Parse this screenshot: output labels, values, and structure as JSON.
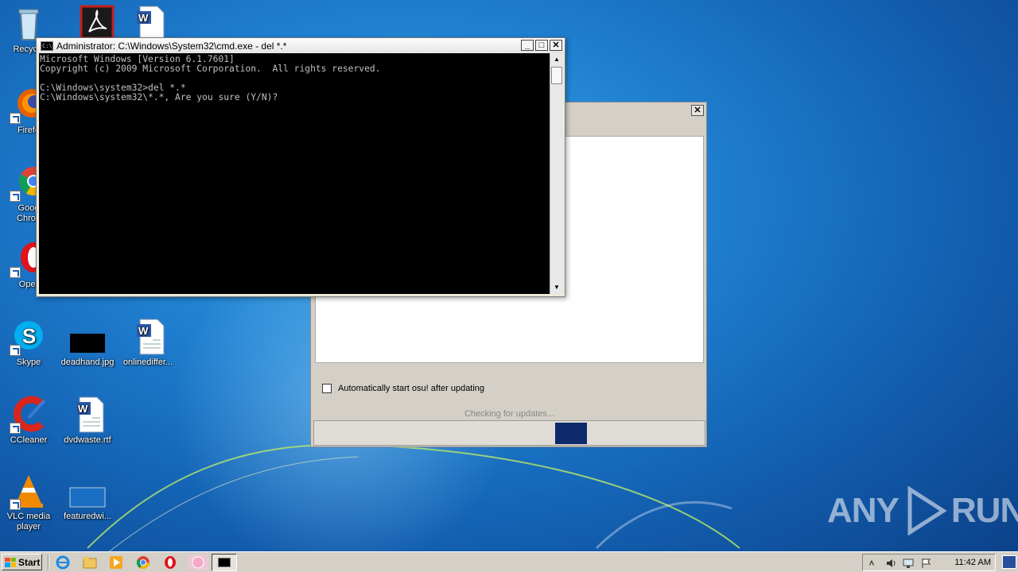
{
  "desktop": {
    "icons": [
      {
        "label": "Recycle",
        "icon": "recycle-bin-icon"
      },
      {
        "label": "Firefox",
        "icon": "firefox-icon"
      },
      {
        "label": "Google Chrome",
        "icon": "chrome-icon"
      },
      {
        "label": "Opera",
        "icon": "opera-icon"
      },
      {
        "label": "Skype",
        "icon": "skype-icon"
      },
      {
        "label": "deadhand.jpg",
        "icon": "image-file-icon"
      },
      {
        "label": "onlinediffer...",
        "icon": "word-doc-icon"
      },
      {
        "label": "CCleaner",
        "icon": "ccleaner-icon"
      },
      {
        "label": "dvdwaste.rtf",
        "icon": "word-doc-icon"
      },
      {
        "label": "VLC media player",
        "icon": "vlc-icon"
      },
      {
        "label": "featuredwi...",
        "icon": "image-file-icon"
      }
    ],
    "partial_labels": {
      "recycle": "Recycle",
      "firefox": "Firefo",
      "chrome_1": "Goog",
      "chrome_2": "Chron",
      "opera": "Oper"
    }
  },
  "cmd": {
    "title": "Administrator: C:\\Windows\\System32\\cmd.exe - del  *.*",
    "icon_text": "C:\\",
    "lines": [
      "Microsoft Windows [Version 6.1.7601]",
      "Copyright (c) 2009 Microsoft Corporation.  All rights reserved.",
      "",
      "C:\\Windows\\system32>del *.*",
      "C:\\Windows\\system32\\*.*, Are you sure (Y/N)?"
    ],
    "min_symbol": "_",
    "max_symbol": "□",
    "close_symbol": "✕"
  },
  "osu_updater": {
    "close_symbol": "✕",
    "checkbox_label": "Automatically start osu! after updating",
    "checkbox_checked": false,
    "status": "Checking for updates..."
  },
  "watermark": {
    "left": "ANY",
    "right": "RUN"
  },
  "taskbar": {
    "start_label": "Start",
    "clock": "11:42 AM",
    "pinned": [
      "internet-explorer-icon",
      "explorer-icon",
      "media-player-icon",
      "chrome-icon",
      "opera-icon",
      "osu-icon",
      "cmd-icon"
    ]
  },
  "colors": {
    "desktop_blue": "#1f7fd0",
    "cmd_background": "#000000",
    "cmd_text": "#c0c0c0",
    "progress_fill": "#0f2a6b"
  }
}
